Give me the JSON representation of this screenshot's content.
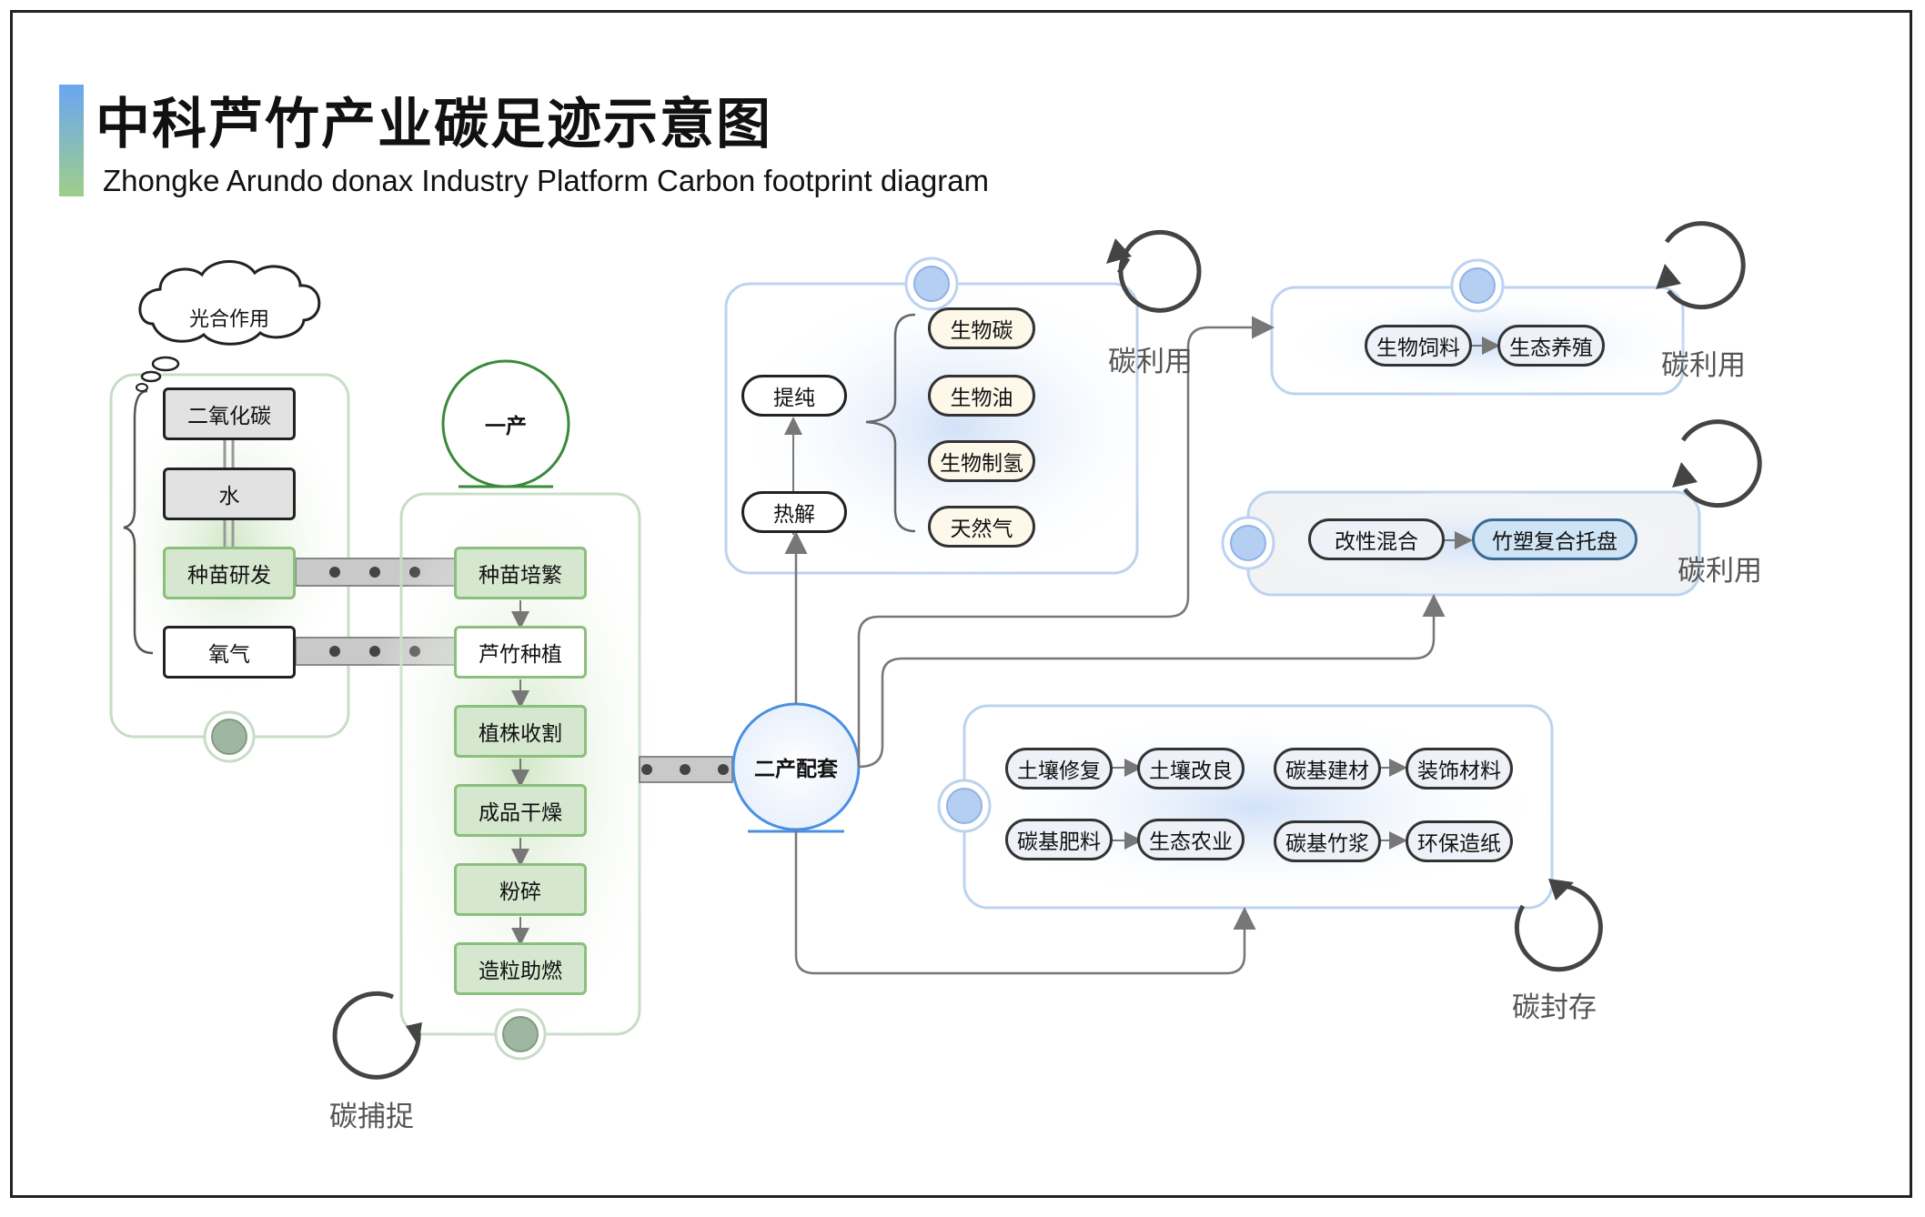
{
  "title": "中科芦竹产业碳足迹示意图",
  "subtitle": "Zhongke Arundo donax Industry Platform  Carbon footprint diagram",
  "photosynthesis": {
    "cloud": "光合作用",
    "items": [
      "二氧化碳",
      "水",
      "种苗研发",
      "氧气"
    ]
  },
  "primary": {
    "node": "一产",
    "steps": [
      "种苗培繁",
      "芦竹种植",
      "植株收割",
      "成品干燥",
      "粉碎",
      "造粒助燃"
    ]
  },
  "secondary": {
    "node": "二产配套"
  },
  "pyrolysis": {
    "inputs": [
      "热解",
      "提纯"
    ],
    "products": [
      "生物碳",
      "生物油",
      "生物制氢",
      "天然气"
    ],
    "label": "碳利用"
  },
  "feed": {
    "items": [
      "生物饲料",
      "生态养殖"
    ],
    "label": "碳利用"
  },
  "composite": {
    "items": [
      "改性混合",
      "竹塑复合托盘"
    ],
    "label": "碳利用"
  },
  "storage": {
    "rows": [
      [
        "土壤修复",
        "土壤改良",
        "碳基建材",
        "装饰材料"
      ],
      [
        "碳基肥料",
        "生态农业",
        "碳基竹浆",
        "环保造纸"
      ]
    ],
    "label": "碳封存"
  },
  "capture_label": "碳捕捉",
  "colors": {
    "green": "#8bbf7c",
    "blue": "#4a90e2",
    "panel_border_green": "#c8dcc6",
    "panel_border_blue": "#bcd3ef"
  }
}
